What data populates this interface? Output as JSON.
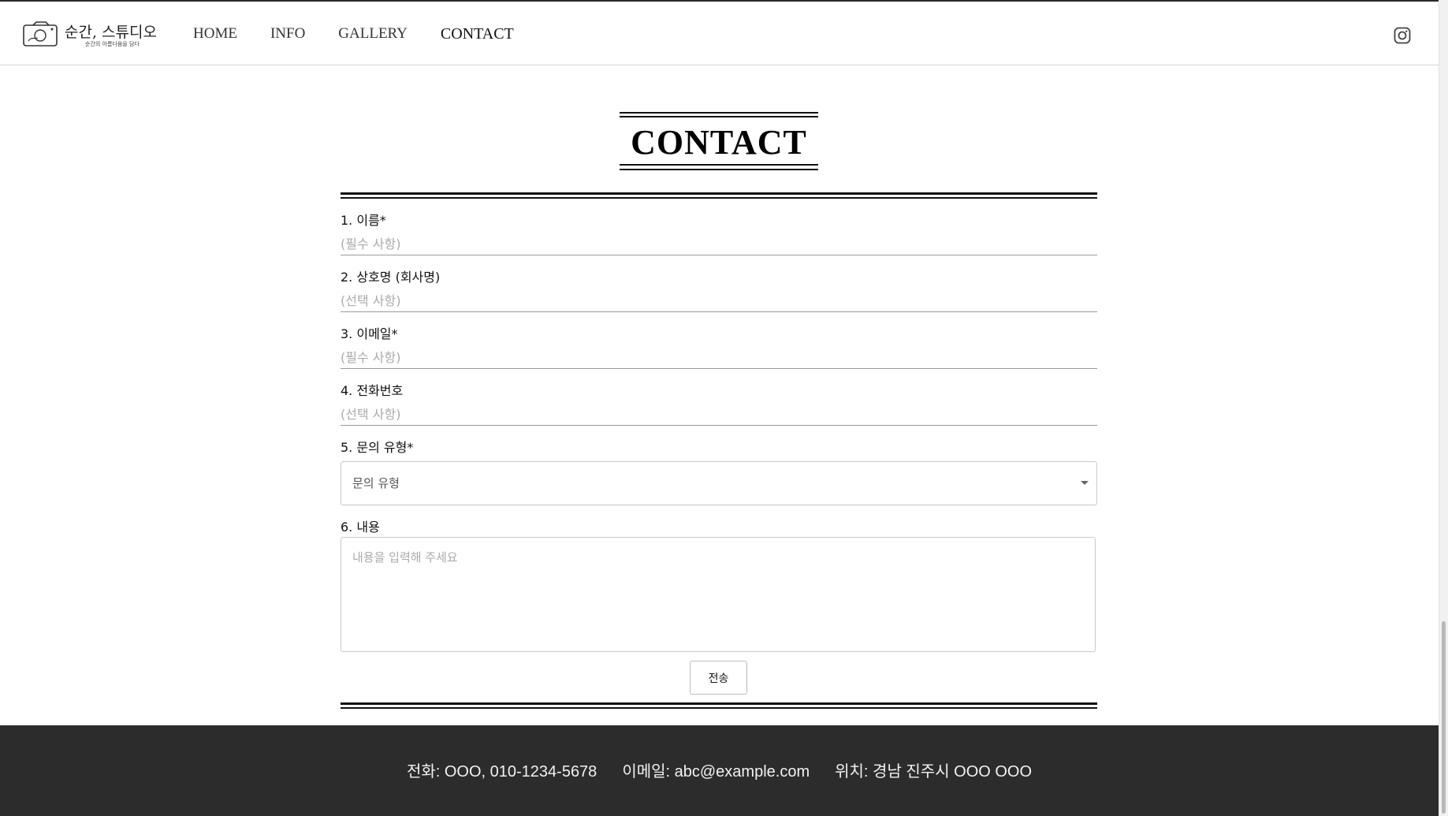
{
  "header": {
    "logo_title": "순간, 스튜디오",
    "logo_subtitle": "순간의 아름다움을 담다",
    "nav": [
      {
        "label": "HOME"
      },
      {
        "label": "INFO"
      },
      {
        "label": "GALLERY"
      },
      {
        "label": "CONTACT"
      }
    ],
    "active_nav": "CONTACT"
  },
  "page_title": "CONTACT",
  "form": {
    "name": {
      "label": "1. 이름*",
      "placeholder": "(필수 사항)"
    },
    "company": {
      "label": "2. 상호명 (회사명)",
      "placeholder": "(선택 사항)"
    },
    "email": {
      "label": "3. 이메일*",
      "placeholder": "(필수 사항)"
    },
    "phone": {
      "label": "4. 전화번호",
      "placeholder": "(선택 사항)"
    },
    "inquiry_type": {
      "label": "5. 문의 유형*",
      "selected": "문의 유형"
    },
    "content": {
      "label": "6. 내용",
      "placeholder": "내용을 입력해 주세요"
    },
    "submit_label": "전송"
  },
  "footer": {
    "phone": "전화: OOO, 010-1234-5678",
    "email": "이메일: abc@example.com",
    "location": "위치: 경남 진주시 OOO OOO"
  },
  "colors": {
    "footer_bg": "#2c2c2c",
    "text": "#111111"
  },
  "icons": {
    "logo": "camera-icon",
    "social": "instagram-icon",
    "select_caret": "caret-down-icon"
  }
}
